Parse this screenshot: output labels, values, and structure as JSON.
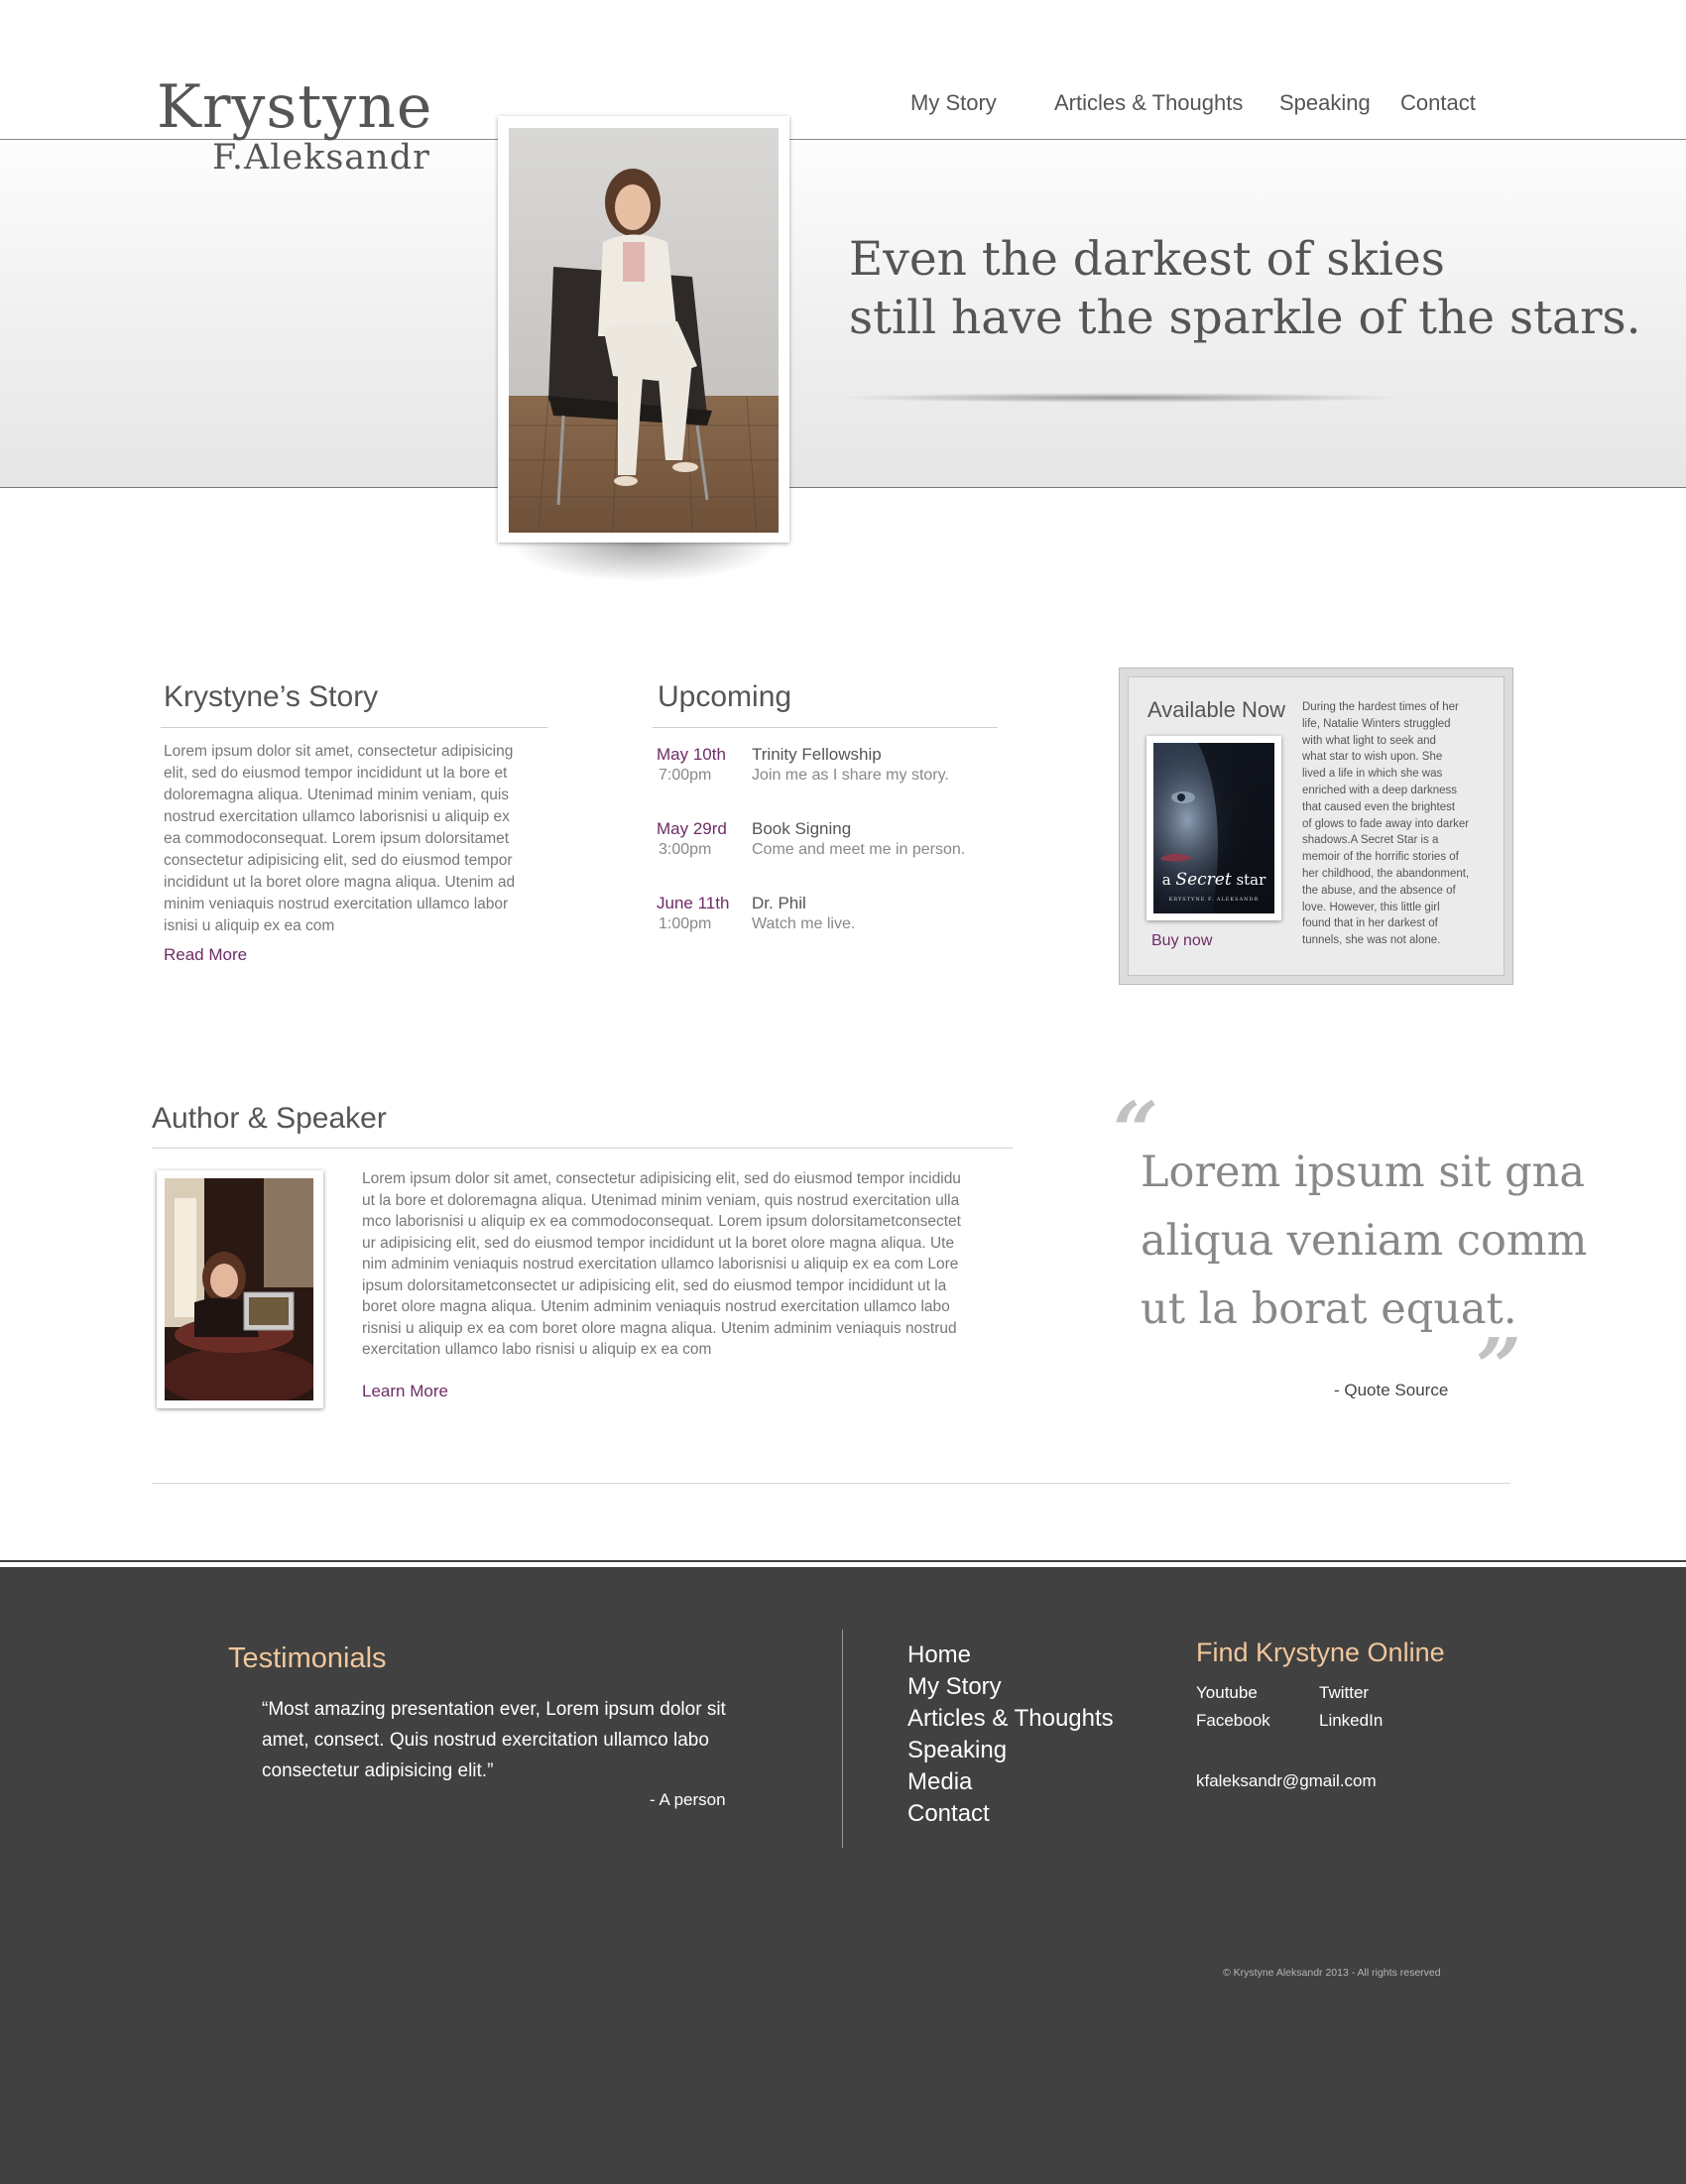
{
  "header": {
    "logo_line1": "Krystyne",
    "logo_line2": "F.Aleksandr",
    "nav": [
      {
        "label": "My Story"
      },
      {
        "label": "Articles & Thoughts"
      },
      {
        "label": "Speaking"
      },
      {
        "label": "Contact"
      }
    ]
  },
  "hero": {
    "quote_line1": "Even the darkest of skies",
    "quote_line2": "still have the sparkle of the stars."
  },
  "story": {
    "heading": "Krystyne’s Story",
    "lines": [
      "Lorem ipsum dolor sit amet, consectetur adipisicing",
      "elit, sed do eiusmod tempor incididunt ut la bore et",
      "doloremagna aliqua. Utenimad minim veniam, quis",
      "nostrud exercitation ullamco laborisnisi u aliquip ex",
      "ea commodoconsequat.  Lorem ipsum dolorsitamet",
      "consectetur adipisicing elit, sed do eiusmod tempor",
      "incididunt ut la boret olore magna aliqua. Utenim ad",
      "minim veniaquis nostrud exercitation ullamco labor",
      "isnisi u aliquip ex ea com"
    ],
    "link": "Read More"
  },
  "upcoming": {
    "heading": "Upcoming",
    "events": [
      {
        "date": "May 10th",
        "time": "7:00pm",
        "title": "Trinity Fellowship",
        "desc": "Join me as I share my story."
      },
      {
        "date": "May 29rd",
        "time": "3:00pm",
        "title": "Book Signing",
        "desc": "Come and meet me in person."
      },
      {
        "date": "June 11th",
        "time": "1:00pm",
        "title": "Dr. Phil",
        "desc": "Watch me live."
      }
    ]
  },
  "available": {
    "heading": "Available Now",
    "book_title_a": "a",
    "book_title_b": "Secret",
    "book_title_c": "star",
    "book_author": "Krystyne F. Aleksandr",
    "buy": "Buy now",
    "lines": [
      "During the hardest times of her",
      "life, Natalie Winters struggled",
      "with what light to seek and",
      "what star to wish upon. She",
      "lived a life in which she was",
      "enriched with a deep darkness",
      "that caused even the brightest",
      "of glows to fade away into darker",
      "shadows.A Secret Star is a",
      "memoir of the horrific stories of",
      "her childhood, the abandonment,",
      "the abuse, and the absence of",
      "love. However, this little girl",
      "found that in her darkest of",
      "tunnels, she was not alone."
    ]
  },
  "author": {
    "heading": "Author & Speaker",
    "lines": [
      "Lorem ipsum dolor sit amet, consectetur adipisicing elit, sed do eiusmod tempor incididu",
      "ut la bore et doloremagna aliqua. Utenimad minim veniam, quis nostrud exercitation ulla",
      "mco laborisnisi u aliquip ex ea commodoconsequat.  Lorem ipsum dolorsitametconsectet",
      "ur adipisicing elit, sed do eiusmod tempor incididunt ut la boret olore magna aliqua. Ute",
      "nim adminim veniaquis nostrud exercitation ullamco laborisnisi u aliquip ex ea com Lore",
      "ipsum dolorsitametconsectet ur adipisicing elit, sed do eiusmod tempor incididunt ut la",
      "boret olore magna aliqua. Utenim adminim veniaquis nostrud exercitation ullamco labo",
      "risnisi u aliquip ex ea com boret olore magna aliqua. Utenim adminim veniaquis nostrud",
      "exercitation ullamco labo risnisi u aliquip ex ea com"
    ],
    "link": "Learn More"
  },
  "pull_quote": {
    "open_mark": "“",
    "close_mark": "”",
    "lines": [
      "Lorem ipsum sit gna",
      "aliqua veniam comm",
      "ut la borat equat."
    ],
    "source": "- Quote Source"
  },
  "footer": {
    "testimonials_heading": "Testimonials",
    "testimonial_lines": [
      "“Most amazing presentation ever, Lorem ipsum dolor sit",
      "amet, consect. Quis nostrud exercitation ullamco labo",
      "consectetur adipisicing elit.”"
    ],
    "testimonial_author": "- A person",
    "nav": [
      "Home",
      "My Story",
      "Articles & Thoughts",
      "Speaking",
      "Media",
      "Contact"
    ],
    "online_heading": "Find Krystyne Online",
    "social": {
      "youtube": "Youtube",
      "twitter": "Twitter",
      "facebook": "Facebook",
      "linkedin": "LinkedIn"
    },
    "email": "kfaleksandr@gmail.com",
    "copyright": "© Krystyne Aleksandr 2013 - All rights reserved"
  }
}
